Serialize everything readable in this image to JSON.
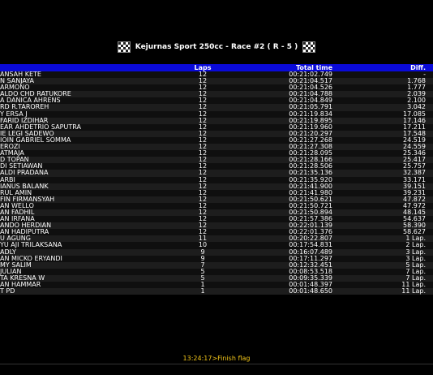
{
  "title": "Kejurnas Sport 250cc - Race #2 ( R - 5 )",
  "columns": {
    "name": "",
    "laps": "Laps",
    "time": "Total time",
    "diff": "Diff."
  },
  "rows": [
    {
      "name": "ANSAH KETE",
      "laps": "12",
      "time": "00:21:02.749",
      "diff": "-"
    },
    {
      "name": "N SANJAYA",
      "laps": "12",
      "time": "00:21:04.517",
      "diff": "1.768"
    },
    {
      "name": "ARMONO",
      "laps": "12",
      "time": "00:21:04.526",
      "diff": "1.777"
    },
    {
      "name": "ALDO CHD RATUKORE",
      "laps": "12",
      "time": "00:21:04.788",
      "diff": "2.039"
    },
    {
      "name": "A DANICA AHRENS",
      "laps": "12",
      "time": "00:21:04.849",
      "diff": "2.100"
    },
    {
      "name": "RD R.TAROREH",
      "laps": "12",
      "time": "00:21:05.791",
      "diff": "3.042"
    },
    {
      "name": "Y ERSA J",
      "laps": "12",
      "time": "00:21:19.834",
      "diff": "17.085"
    },
    {
      "name": "FARID IZDIHAR",
      "laps": "12",
      "time": "00:21:19.895",
      "diff": "17.146"
    },
    {
      "name": "EAR AHDETRIO SAPUTRA",
      "laps": "12",
      "time": "00:21:19.960",
      "diff": "17.211"
    },
    {
      "name": "IE LEGI SADEWO",
      "laps": "12",
      "time": "00:21:20.297",
      "diff": "17.548"
    },
    {
      "name": "IOIN GABRIEL SOMMA",
      "laps": "12",
      "time": "00:21:27.268",
      "diff": "24.519"
    },
    {
      "name": "EROZI",
      "laps": "12",
      "time": "00:21:27.308",
      "diff": "24.559"
    },
    {
      "name": "ATMAJA",
      "laps": "12",
      "time": "00:21:28.095",
      "diff": "25.346"
    },
    {
      "name": "D TOPAN",
      "laps": "12",
      "time": "00:21:28.166",
      "diff": "25.417"
    },
    {
      "name": "DI SETIAWAN",
      "laps": "12",
      "time": "00:21:28.506",
      "diff": "25.757"
    },
    {
      "name": "ALDI PRADANA",
      "laps": "12",
      "time": "00:21:35.136",
      "diff": "32.387"
    },
    {
      "name": "ARBI",
      "laps": "12",
      "time": "00:21:35.920",
      "diff": "33.171"
    },
    {
      "name": "IANUS BALANK",
      "laps": "12",
      "time": "00:21:41.900",
      "diff": "39.151"
    },
    {
      "name": "RUL AMIN",
      "laps": "12",
      "time": "00:21:41.980",
      "diff": "39.231"
    },
    {
      "name": "FIN FIRMANSYAH",
      "laps": "12",
      "time": "00:21:50.621",
      "diff": "47.872"
    },
    {
      "name": "AN WELLO",
      "laps": "12",
      "time": "00:21:50.721",
      "diff": "47.972"
    },
    {
      "name": "AN FADHIL",
      "laps": "12",
      "time": "00:21:50.894",
      "diff": "48.145"
    },
    {
      "name": "AN IRFANA",
      "laps": "12",
      "time": "00:21:57.386",
      "diff": "54.637"
    },
    {
      "name": "ANDO HERDIAN",
      "laps": "12",
      "time": "00:22:01.139",
      "diff": "58.390"
    },
    {
      "name": "AN HADIPUTRA",
      "laps": "12",
      "time": "00:22:01.376",
      "diff": "58.627"
    },
    {
      "name": "U AGUNG",
      "laps": "11",
      "time": "00:20:22.807",
      "diff": "1 Lap."
    },
    {
      "name": "YU AJI TRILAKSANA",
      "laps": "10",
      "time": "00:17:54.831",
      "diff": "2 Lap."
    },
    {
      "name": "ADLY",
      "laps": "9",
      "time": "00:16:07.489",
      "diff": "3 Lap."
    },
    {
      "name": "AN MICKO ERYANDI",
      "laps": "9",
      "time": "00:17:11.297",
      "diff": "3 Lap."
    },
    {
      "name": "MY SALIM",
      "laps": "7",
      "time": "00:12:32.451",
      "diff": "5 Lap."
    },
    {
      "name": "JULIAN",
      "laps": "5",
      "time": "00:08:53.518",
      "diff": "7 Lap."
    },
    {
      "name": "TA KRESNA W",
      "laps": "5",
      "time": "00:09:35.339",
      "diff": "7 Lap."
    },
    {
      "name": "AN HAMMAR",
      "laps": "1",
      "time": "00:01:48.397",
      "diff": "11 Lap."
    },
    {
      "name": "T PD",
      "laps": "1",
      "time": "00:01:48.650",
      "diff": "11 Lap."
    }
  ],
  "footer": "13:24:17>Finish flag"
}
